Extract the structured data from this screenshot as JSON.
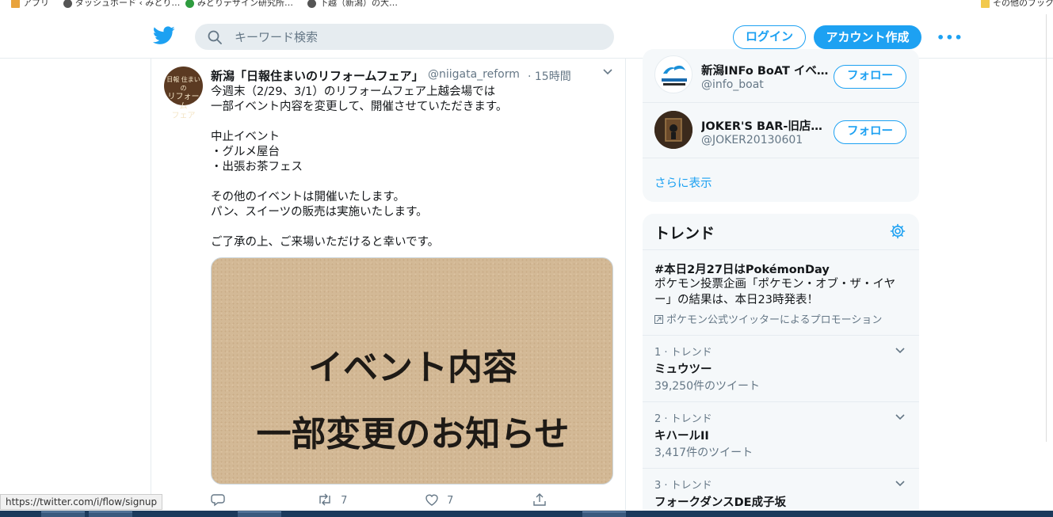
{
  "bookmarks": [
    {
      "label": "アプリ",
      "color": "#e8a33d"
    },
    {
      "label": "ダッシュボード ‹ みとり…",
      "color": "#555555"
    },
    {
      "label": "みどりデザイン研究所…",
      "color": "#2e9c3f"
    },
    {
      "label": "下越（新潟）の大…",
      "color": "#555555"
    },
    {
      "label": "その他のブックマ",
      "color": "#f2c94c"
    }
  ],
  "header": {
    "search_placeholder": "キーワード検索",
    "login_label": "ログイン",
    "signup_label": "アカウント作成",
    "more_label": "•••",
    "brand_color": "#1da1f2"
  },
  "tweet": {
    "avatar_text_top": "日報 住まいの",
    "avatar_text_mid": "リフォーム",
    "avatar_text_bot": "フェア",
    "name": "新潟「日報住まいのリフォームフェア」",
    "handle": "@niigata_reform",
    "time": "· 15時間",
    "text": "今週末（2/29、3/1）のリフォームフェア上越会場では\n一部イベント内容を変更して、開催させていただきます。\n\n中止イベント\n・グルメ屋台\n・出張お茶フェス\n\nその他のイベントは開催いたします。\nパン、スイーツの販売は実施いたします。\n\nご了承の上、ご来場いただけると幸いです。",
    "image_line1": "イベント内容",
    "image_line2": "一部変更のお知らせ",
    "retweets": "7",
    "likes": "7"
  },
  "follow_suggestions": [
    {
      "name": "新潟INFo BoAT イベ…",
      "handle": "@info_boat",
      "button": "フォロー"
    },
    {
      "name": "JOKER'S BAR-旧店…",
      "handle": "@JOKER20130601",
      "button": "フォロー"
    }
  ],
  "show_more": "さらに表示",
  "trends": {
    "title": "トレンド",
    "promoted": {
      "title": "#本日2月27日はPokémonDay",
      "desc": "ポケモン投票企画「ポケモン・オブ・ザ・イヤー」の結果は、本日23時発表！",
      "by": "ポケモン公式ツイッターによるプロモーション"
    },
    "items": [
      {
        "rank": "1 · トレンド",
        "name": "ミュウツー",
        "count": "39,250件のツイート"
      },
      {
        "rank": "2 · トレンド",
        "name": "キハールII",
        "count": "3,417件のツイート"
      },
      {
        "rank": "3 · トレンド",
        "name": "フォークダンスDE成子坂",
        "count": ""
      }
    ]
  },
  "status_url": "https://twitter.com/i/flow/signup"
}
